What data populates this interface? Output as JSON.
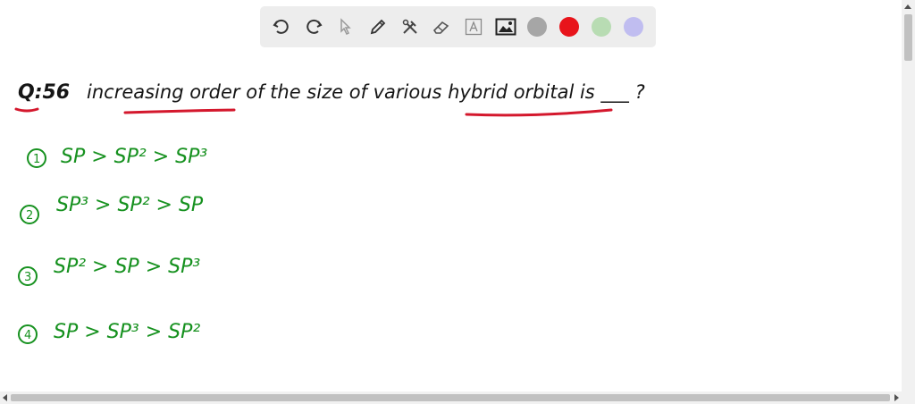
{
  "toolbar": {
    "tools": [
      "undo-icon",
      "redo-icon",
      "pointer-icon",
      "pen-icon",
      "tools-icon",
      "eraser-icon",
      "text-icon",
      "image-icon"
    ],
    "colors": [
      "#a6a6a6",
      "#e8141b",
      "#b8dcb3",
      "#c0bdf0"
    ]
  },
  "question": {
    "label": "Q:56",
    "text": "increasing order of the size of various hybrid orbital is ___ ?"
  },
  "options": [
    {
      "num": "1",
      "text": "SP > SP² > SP³"
    },
    {
      "num": "2",
      "text": "SP³ > SP² > SP"
    },
    {
      "num": "3",
      "text": "SP² > SP > SP³"
    },
    {
      "num": "4",
      "text": "SP > SP³ > SP²"
    }
  ],
  "colors": {
    "ink_black": "#151515",
    "ink_green": "#16911f",
    "underline_red": "#d4182d"
  }
}
